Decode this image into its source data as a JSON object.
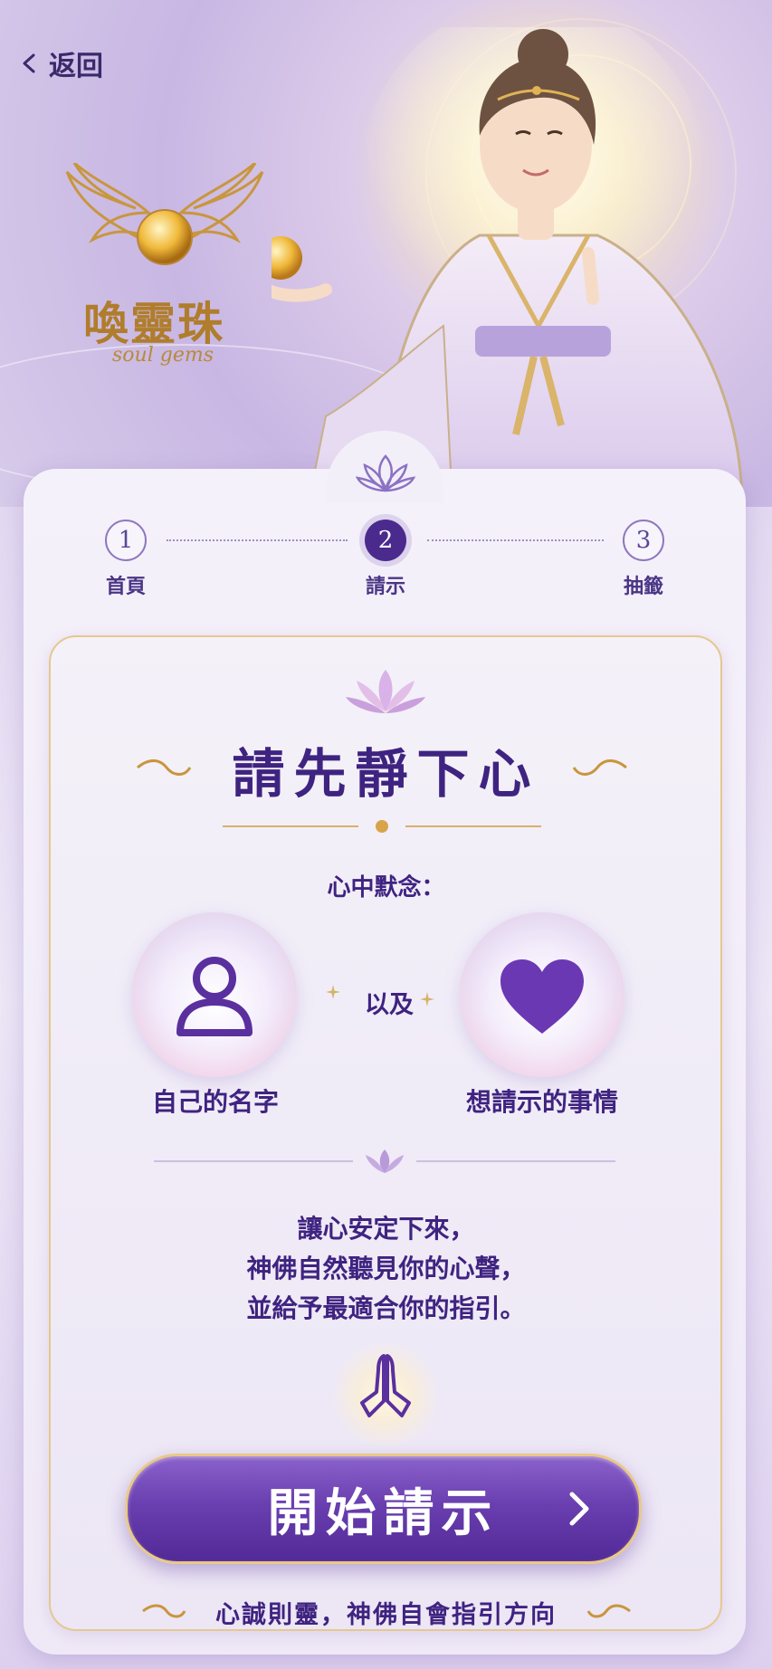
{
  "header": {
    "back_label": "返回"
  },
  "logo": {
    "title": "喚靈珠",
    "subtitle": "soul gems"
  },
  "stepper": {
    "steps": [
      {
        "number": "1",
        "label": "首頁",
        "active": false
      },
      {
        "number": "2",
        "label": "請示",
        "active": true
      },
      {
        "number": "3",
        "label": "抽籤",
        "active": false
      }
    ]
  },
  "main": {
    "title": "請先靜下心",
    "prompt": "心中默念：",
    "item_left": "自己的名字",
    "connector": "以及",
    "item_right": "想請示的事情",
    "message": [
      "讓心安定下來，",
      "神佛自然聽見你的心聲，",
      "並給予最適合你的指引。"
    ],
    "start_button": "開始請示",
    "footer": "心誠則靈，神佛自會指引方向"
  },
  "icons": [
    "back-chevron-icon",
    "wings-orb-logo-icon",
    "lotus-icon",
    "person-icon",
    "heart-icon",
    "praying-hands-icon",
    "chevron-right-icon"
  ],
  "colors": {
    "primary": "#4b2a8e",
    "accent_gold": "#e5c88f",
    "text": "#3f2380",
    "button_top": "#8b62cc",
    "button_bottom": "#522a97"
  }
}
